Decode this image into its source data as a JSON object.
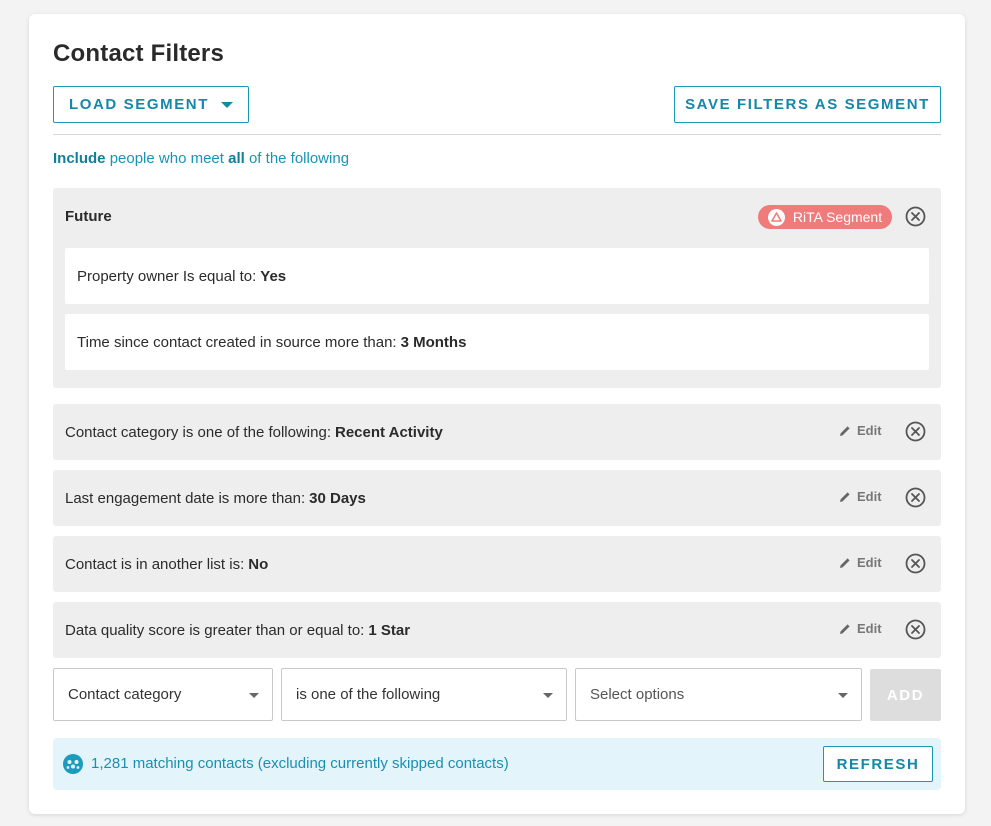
{
  "page": {
    "title": "Contact Filters"
  },
  "toolbar": {
    "load_segment_label": "LOAD SEGMENT",
    "save_segment_label": "SAVE FILTERS AS SEGMENT"
  },
  "include_line": {
    "include": "Include",
    "middle": "people who meet",
    "all": "all",
    "end": "of the following"
  },
  "segment_group": {
    "name": "Future",
    "badge_label": "RiTA Segment",
    "rows": [
      {
        "label": "Property owner Is equal to:",
        "value": "Yes"
      },
      {
        "label": "Time since contact created in source more than:",
        "value": "3 Months"
      }
    ]
  },
  "filters": [
    {
      "label": "Contact category is one of the following:",
      "value": "Recent Activity",
      "edit_label": "Edit"
    },
    {
      "label": "Last engagement date is more than:",
      "value": "30 Days",
      "edit_label": "Edit"
    },
    {
      "label": "Contact is in another list is:",
      "value": "No",
      "edit_label": "Edit"
    },
    {
      "label": "Data quality score is greater than or equal to:",
      "value": "1 Star",
      "edit_label": "Edit"
    }
  ],
  "new_filter": {
    "field_value": "Contact category",
    "operator_value": "is one of the following",
    "options_placeholder": "Select options",
    "add_label": "ADD"
  },
  "match_bar": {
    "text": "1,281 matching contacts (excluding currently skipped contacts)",
    "refresh_label": "REFRESH"
  },
  "colors": {
    "accent": "#1488a8",
    "badge": "#f07b7b",
    "row_bg": "#eeeeee",
    "match_bg": "#e3f4fa"
  },
  "icons": {
    "load_caret": "caret-down-icon",
    "badge_icon": "warning-triangle-icon",
    "remove": "circle-x-icon",
    "edit": "pencil-icon",
    "match": "people-group-icon"
  }
}
